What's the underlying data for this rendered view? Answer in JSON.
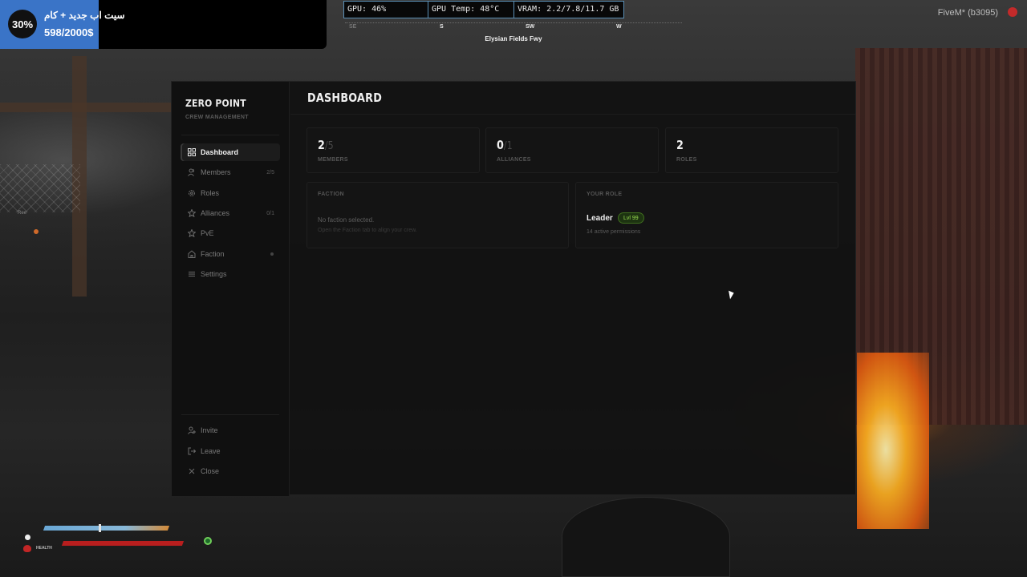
{
  "promo": {
    "badge": "30%",
    "title": "سيت اب جديد + كام",
    "price": "598/2000$"
  },
  "perf": {
    "gpu": "GPU: 46%",
    "temp": "GPU Temp: 48°C",
    "vram": "VRAM: 2.2/7.8/11.7 GB"
  },
  "compass": {
    "se": "SE",
    "s": "S",
    "sw": "SW",
    "w": "W"
  },
  "street": "Elysian Fields Fwy",
  "client": "FiveM* (b3095)",
  "sidebar": {
    "brand": "ZERO POINT",
    "subtitle": "CREW MANAGEMENT",
    "items": [
      {
        "label": "Dashboard",
        "icon": "grid-icon",
        "count": ""
      },
      {
        "label": "Members",
        "icon": "users-icon",
        "count": "2/5"
      },
      {
        "label": "Roles",
        "icon": "gear-icon",
        "count": ""
      },
      {
        "label": "Alliances",
        "icon": "star-icon",
        "count": "0/1"
      },
      {
        "label": "PvE",
        "icon": "star-outline-icon",
        "count": ""
      },
      {
        "label": "Faction",
        "icon": "home-icon",
        "count": ""
      },
      {
        "label": "Settings",
        "icon": "lines-icon",
        "count": ""
      }
    ],
    "footer": [
      {
        "label": "Invite",
        "icon": "user-plus-icon"
      },
      {
        "label": "Leave",
        "icon": "logout-icon"
      },
      {
        "label": "Close",
        "icon": "close-icon"
      }
    ]
  },
  "dashboard": {
    "title": "DASHBOARD",
    "stats": [
      {
        "value": "2",
        "total": "/5",
        "label": "MEMBERS"
      },
      {
        "value": "0",
        "total": "/1",
        "label": "ALLIANCES"
      },
      {
        "value": "2",
        "total": "",
        "label": "ROLES"
      }
    ],
    "faction": {
      "heading": "FACTION",
      "message": "No faction selected.",
      "hint": "Open the Faction tab to align your crew."
    },
    "role": {
      "heading": "YOUR ROLE",
      "name": "Leader",
      "level": "Lvl 99",
      "permissions": "14 active permissions"
    }
  },
  "hud": {
    "health_label": "HEALTH",
    "armor_level": 0.75,
    "health_level": 1.0
  },
  "voice": "Ree",
  "colors": {
    "promo_blue": "#3a74c7",
    "perf_border": "#5b8fb5",
    "level_green": "#9adf52",
    "health_red": "#b81e1e"
  }
}
